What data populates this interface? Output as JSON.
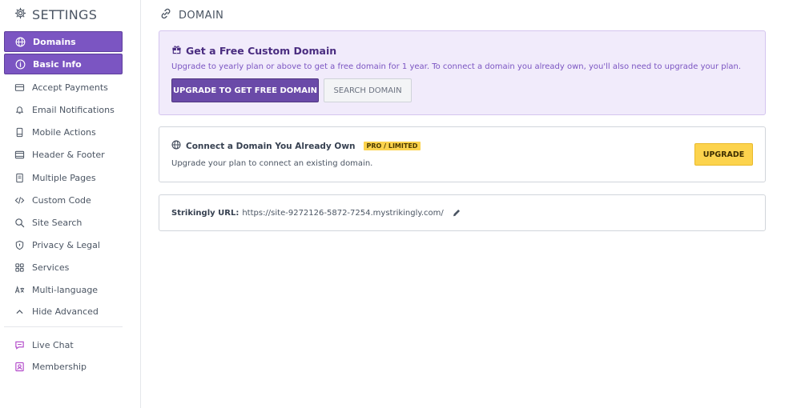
{
  "sidebar": {
    "title": "SETTINGS",
    "items": [
      {
        "label": "Domains",
        "icon": "globe-icon"
      },
      {
        "label": "Basic Info",
        "icon": "info-icon"
      },
      {
        "label": "Accept Payments",
        "icon": "credit-card-icon"
      },
      {
        "label": "Email Notifications",
        "icon": "bell-icon"
      },
      {
        "label": "Mobile Actions",
        "icon": "mobile-icon"
      },
      {
        "label": "Header & Footer",
        "icon": "layout-icon"
      },
      {
        "label": "Multiple Pages",
        "icon": "pages-icon"
      },
      {
        "label": "Custom Code",
        "icon": "code-icon"
      },
      {
        "label": "Site Search",
        "icon": "search-icon"
      },
      {
        "label": "Privacy & Legal",
        "icon": "shield-icon"
      },
      {
        "label": "Services",
        "icon": "grid-icon"
      },
      {
        "label": "Multi-language",
        "icon": "language-icon"
      },
      {
        "label": "Hide Advanced",
        "icon": "chevron-up-icon"
      },
      {
        "label": "Live Chat",
        "icon": "chat-icon"
      },
      {
        "label": "Membership",
        "icon": "member-icon"
      }
    ]
  },
  "main": {
    "title": "DOMAIN",
    "promo": {
      "title": "Get a Free Custom Domain",
      "description": "Upgrade to yearly plan or above to get a free domain for 1 year. To connect a domain you already own, you'll also need to upgrade your plan.",
      "primary_button": "UPGRADE TO GET FREE DOMAIN",
      "secondary_button": "SEARCH DOMAIN"
    },
    "connect": {
      "title": "Connect a Domain You Already Own",
      "badge": "PRO / LIMITED",
      "description": "Upgrade your plan to connect an existing domain.",
      "button": "UPGRADE"
    },
    "url": {
      "label": "Strikingly URL:",
      "value": "https://site-9272126-5872-7254.mystrikingly.com/"
    }
  },
  "colors": {
    "accent": "#7b55c2",
    "promo_bg": "#f1ebfb",
    "upgrade_yellow": "#fcd34d"
  }
}
